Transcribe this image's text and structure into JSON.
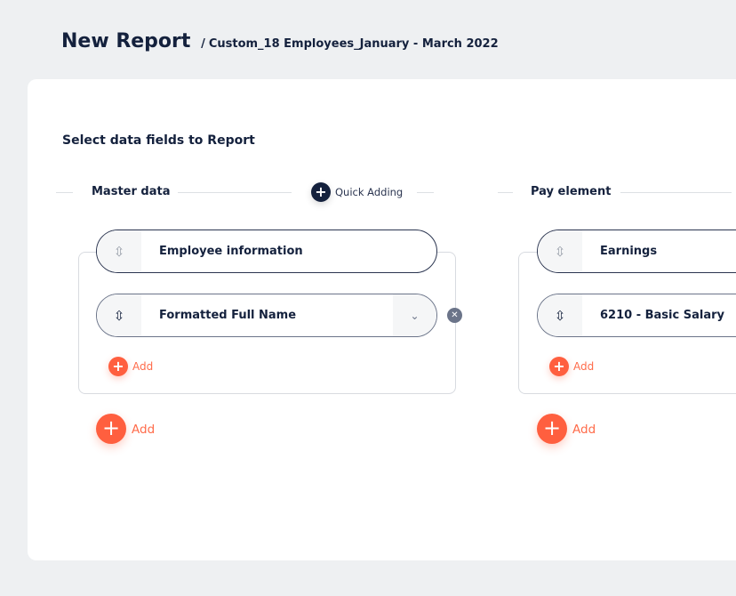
{
  "header": {
    "title": "New Report",
    "separator": "/",
    "subtitle": "Custom_18 Employees_January - March 2022"
  },
  "main": {
    "heading": "Select data fields to Report",
    "quick_add_label": "Quick Adding",
    "sections": [
      {
        "title": "Master data",
        "group": "Employee information",
        "fields": [
          "Formatted Full Name"
        ],
        "add_label": "Add",
        "add_group_label": "Add"
      },
      {
        "title": "Pay element",
        "group": "Earnings",
        "fields": [
          "6210 - Basic Salary"
        ],
        "add_label": "Add",
        "add_group_label": "Add"
      }
    ]
  },
  "icons": {
    "drag": "sort-handle-icon",
    "chevron": "chevron-down-icon",
    "close": "close-circle-icon",
    "plus": "plus-icon"
  },
  "colors": {
    "accent": "#ff5f3f",
    "navy": "#14213d",
    "background": "#eef0f2"
  }
}
